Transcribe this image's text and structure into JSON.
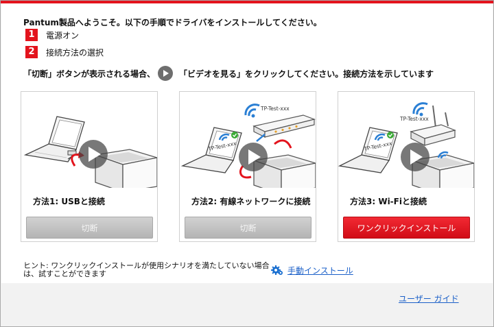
{
  "welcome": "Pantum製品へようこそ。以下の手順でドライバをインストールしてください。",
  "steps": [
    {
      "num": "1",
      "label": "電源オン"
    },
    {
      "num": "2",
      "label": "接続方法の選択"
    }
  ],
  "instruction": {
    "before": "「切断」ボタンが表示される場合、",
    "after": "「ビデオを見る」をクリックしてください。接続方法を示しています"
  },
  "methods": [
    {
      "title": "方法1: USBと接続",
      "button": "切断",
      "button_state": "disabled"
    },
    {
      "title": "方法2: 有線ネットワークに接続",
      "button": "切断",
      "button_state": "disabled",
      "router_label": "TP-Test-xxx",
      "laptop_label": "TP-Test-xxx"
    },
    {
      "title": "方法3: Wi-Fiと接続",
      "button": "ワンクリックインストール",
      "button_state": "primary",
      "router_label": "TP-Test-xxx",
      "laptop_label": "TP-Test-xxx"
    }
  ],
  "note": "ヒント: ワンクリックインストールが使用シナリオを満たしていない場合は、試すことができます",
  "manual_install": "手動インストール",
  "user_guide": "ユーザー ガイド",
  "colors": {
    "accent": "#e3141d",
    "link": "#1a5fc8",
    "wifi": "#2a7fd4",
    "check": "#3aaa35"
  }
}
